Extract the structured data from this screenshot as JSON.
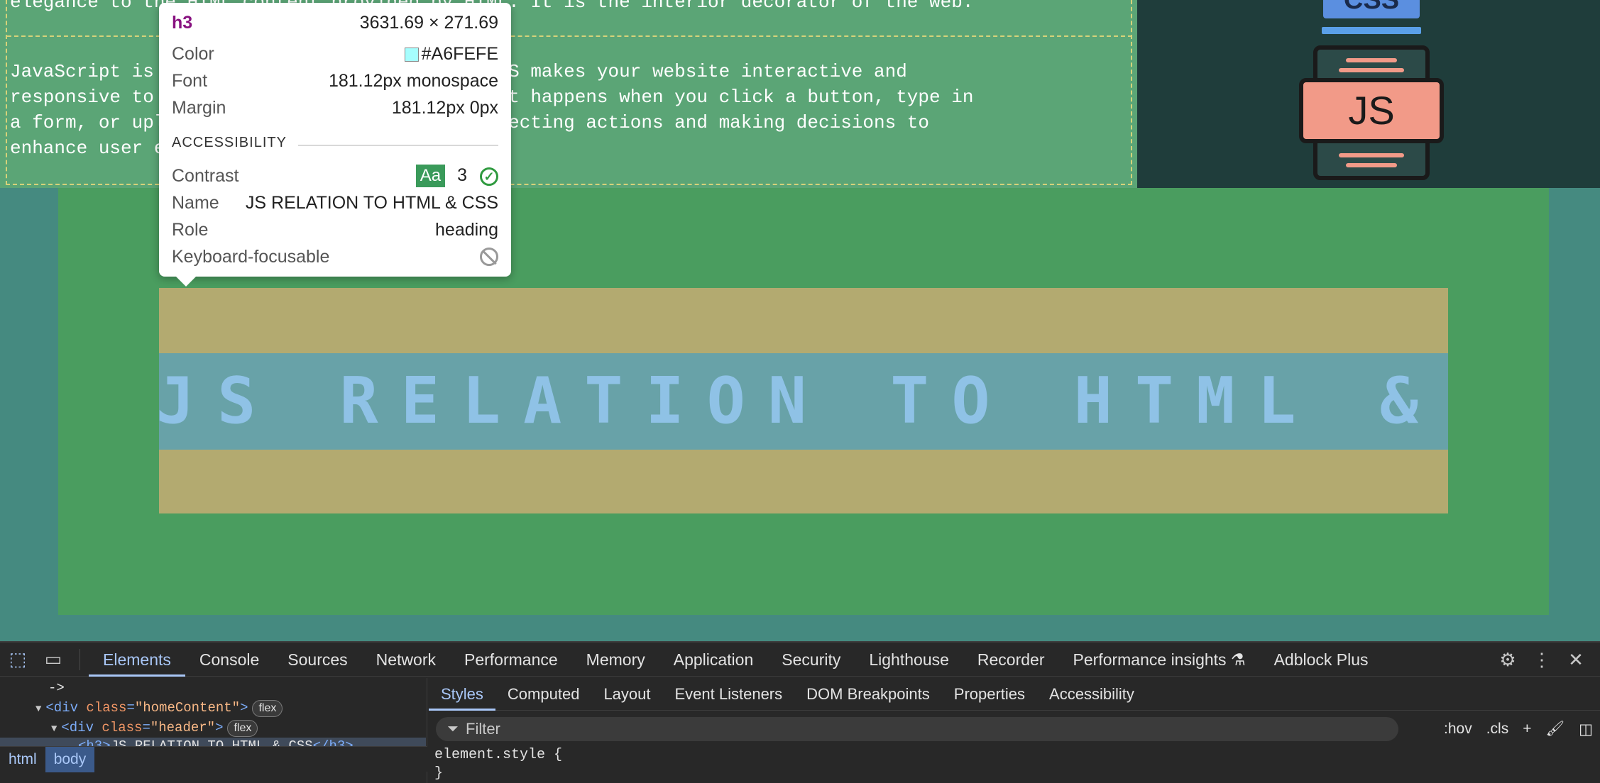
{
  "page": {
    "para_top": "elegance to the HTML content provided by HTML. It is the interior decorator of the web.",
    "para_js_lines": [
      "JavaScript is the behavior of your webpage. JS makes your website interactive and",
      "responsive to user. JavaScript can handle what happens when you click a button, type in",
      "a form, or upload a file - the operation, directing actions and making decisions to",
      "enhance user experience."
    ],
    "css_badge": "CSS",
    "js_badge": "JS",
    "heading": "JS RELATION TO HTML & CSS"
  },
  "tooltip": {
    "tag": "h3",
    "dimensions": "3631.69 × 271.69",
    "color_label": "Color",
    "color_value": "#A6FEFE",
    "font_label": "Font",
    "font_value": "181.12px monospace",
    "margin_label": "Margin",
    "margin_value": "181.12px 0px",
    "accessibility_title": "ACCESSIBILITY",
    "contrast_label": "Contrast",
    "contrast_aa": "Aa",
    "contrast_value": "3",
    "name_label": "Name",
    "name_value": "JS RELATION TO HTML & CSS",
    "role_label": "Role",
    "role_value": "heading",
    "focusable_label": "Keyboard-focusable"
  },
  "devtools": {
    "tabs": [
      "Elements",
      "Console",
      "Sources",
      "Network",
      "Performance",
      "Memory",
      "Application",
      "Security",
      "Lighthouse",
      "Recorder",
      "Performance insights ⚗",
      "Adblock Plus"
    ],
    "active_tab": "Elements",
    "dom": {
      "comment_tail": "->",
      "line1_tag_open": "<div ",
      "line1_attr": "class",
      "line1_value": "\"homeContent\"",
      "line1_close": ">",
      "line2_tag_open": "<div ",
      "line2_attr": "class",
      "line2_value": "\"header\"",
      "line2_close": ">",
      "flex_badge": "flex",
      "h3_open": "<h3>",
      "h3_text": "JS RELATION TO HTML & CSS",
      "h3_close": "</h3>"
    },
    "breadcrumbs": [
      "html",
      "body"
    ],
    "sub_tabs": [
      "Styles",
      "Computed",
      "Layout",
      "Event Listeners",
      "DOM Breakpoints",
      "Properties",
      "Accessibility"
    ],
    "filter_placeholder": "Filter",
    "hov": ":hov",
    "cls": ".cls",
    "element_style_open": "element.style {",
    "element_style_close": "}"
  },
  "colors": {
    "swatch": "#A6FEFE",
    "accent": "#a9c7f7"
  }
}
